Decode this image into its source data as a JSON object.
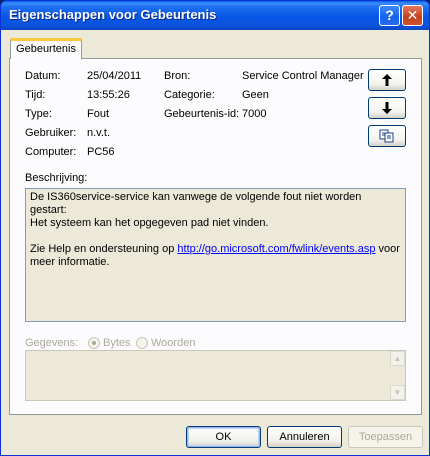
{
  "window": {
    "title": "Eigenschappen voor Gebeurtenis",
    "help_glyph": "?",
    "close_glyph": "✕"
  },
  "tabs": [
    {
      "label": "Gebeurtenis"
    }
  ],
  "fields": {
    "datum_label": "Datum:",
    "datum": "25/04/2011",
    "tijd_label": "Tijd:",
    "tijd": "13:55:26",
    "type_label": "Type:",
    "type": "Fout",
    "gebruiker_label": "Gebruiker:",
    "gebruiker": "n.v.t.",
    "computer_label": "Computer:",
    "computer": "PC56",
    "bron_label": "Bron:",
    "bron": "Service Control Manager",
    "categorie_label": "Categorie:",
    "categorie": "Geen",
    "gebeurtenis_id_label": "Gebeurtenis-id:",
    "gebeurtenis_id": "7000"
  },
  "nav_buttons": {
    "up_icon": "arrow-up-icon",
    "down_icon": "arrow-down-icon",
    "copy_icon": "copy-icon"
  },
  "description": {
    "label": "Beschrijving:",
    "line1": "De IS360service-service kan vanwege de volgende fout niet worden gestart:",
    "line2": "Het systeem kan het opgegeven pad niet vinden.",
    "line3_prefix": "Zie Help en ondersteuning op ",
    "link": "http://go.microsoft.com/fwlink/events.asp",
    "line3_suffix": " voor",
    "line4": "meer informatie."
  },
  "data_section": {
    "label": "Gegevens:",
    "radio_bytes": "Bytes",
    "radio_woorden": "Woorden",
    "selected": "Bytes"
  },
  "footer": {
    "ok": "OK",
    "annuleren": "Annuleren",
    "toepassen": "Toepassen"
  },
  "colors": {
    "titlebar": "#0756e6",
    "face": "#ece9d8",
    "link": "#0000ff",
    "disabled": "#aca899"
  }
}
